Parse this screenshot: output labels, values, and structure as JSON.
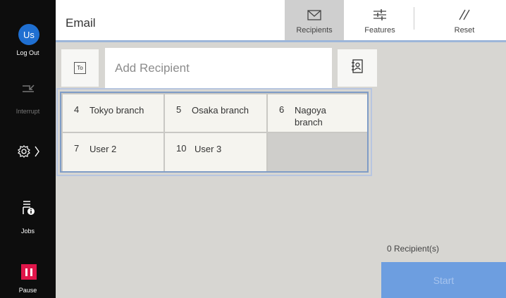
{
  "sidebar": {
    "user_initials": "Us",
    "logout_label": "Log Out",
    "interrupt_label": "Interrupt",
    "jobs_label": "Jobs",
    "pause_label": "Pause"
  },
  "header": {
    "title": "Email",
    "tabs": [
      {
        "label": "Recipients",
        "icon": "envelope-icon",
        "active": true
      },
      {
        "label": "Features",
        "icon": "sliders-icon",
        "active": false
      },
      {
        "label": "Reset",
        "icon": "reset-slash-icon",
        "active": false
      }
    ]
  },
  "recipient": {
    "to_label": "To",
    "placeholder": "Add Recipient"
  },
  "speed_dial": [
    {
      "num": "4",
      "name": "Tokyo branch"
    },
    {
      "num": "5",
      "name": "Osaka branch"
    },
    {
      "num": "6",
      "name": "Nagoya branch"
    },
    {
      "num": "7",
      "name": "User 2"
    },
    {
      "num": "10",
      "name": "User 3"
    }
  ],
  "status": {
    "recipient_count": "0 Recipient(s)",
    "start_label": "Start"
  },
  "colors": {
    "accent": "#1f6fd1",
    "start_button": "#6d9ee0",
    "pause": "#e0164a"
  }
}
